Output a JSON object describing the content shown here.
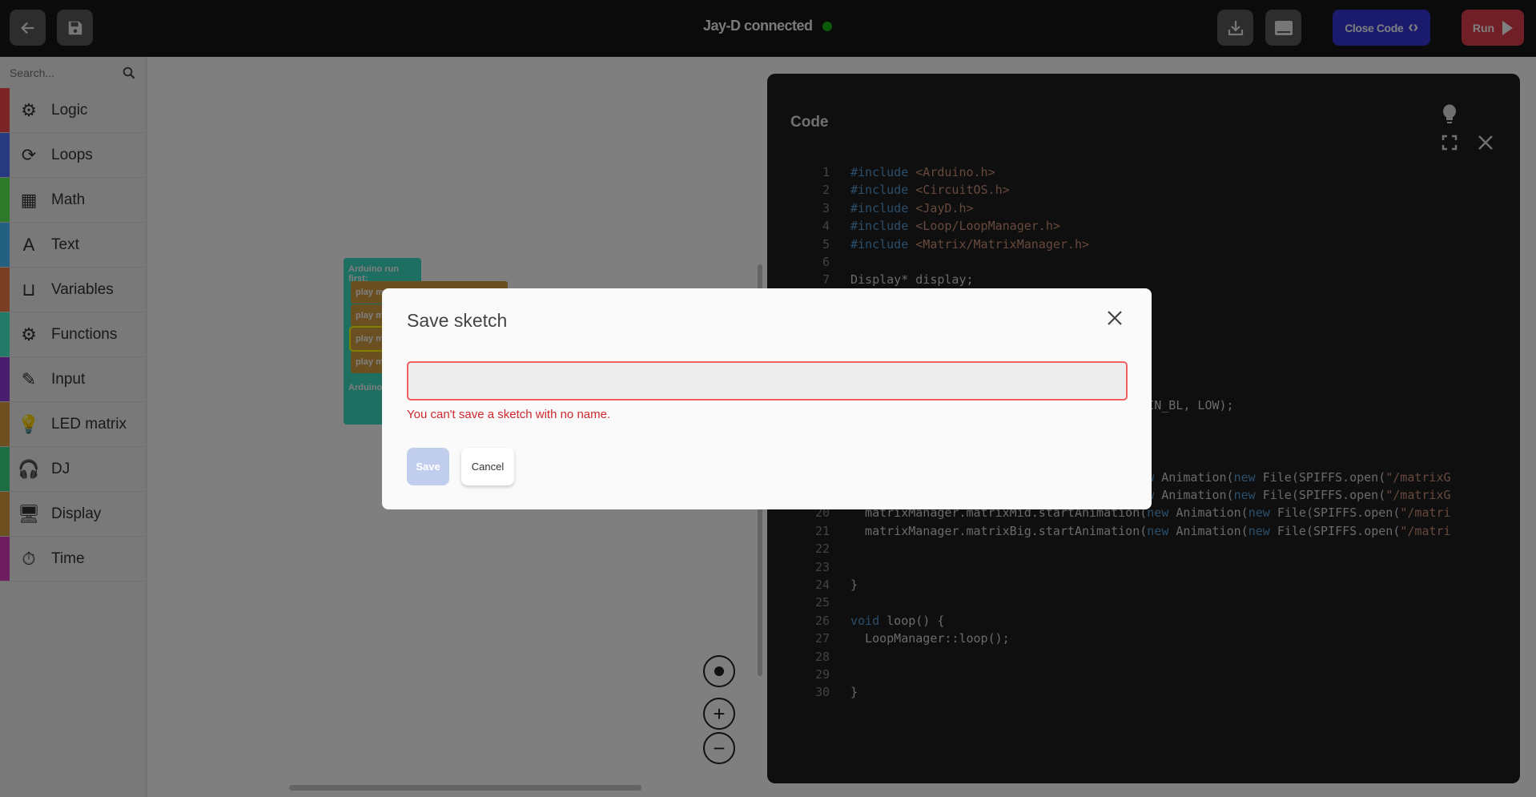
{
  "topbar": {
    "status": "Jay-D connected",
    "status_color": "#14b414",
    "close_code_label": "Close Code",
    "run_label": "Run"
  },
  "sidebar": {
    "search_placeholder": "Search...",
    "items": [
      {
        "label": "Logic",
        "icon": "gears-icon",
        "glyph": "⚙",
        "color": "#fa4a4c"
      },
      {
        "label": "Loops",
        "icon": "refresh-icon",
        "glyph": "⟳",
        "color": "#5074ff"
      },
      {
        "label": "Math",
        "icon": "calculator-icon",
        "glyph": "▦",
        "color": "#5ef454"
      },
      {
        "label": "Text",
        "icon": "font-icon",
        "glyph": "A",
        "color": "#48c0ff"
      },
      {
        "label": "Variables",
        "icon": "inbox-icon",
        "glyph": "⊔",
        "color": "#f47c44"
      },
      {
        "label": "Functions",
        "icon": "cog-icon",
        "glyph": "⚙",
        "color": "#46f4cc"
      },
      {
        "label": "Input",
        "icon": "edit-icon",
        "glyph": "✎",
        "color": "#943cdc"
      },
      {
        "label": "LED matrix",
        "icon": "lightbulb-icon",
        "glyph": "💡",
        "color": "#dca040"
      },
      {
        "label": "DJ",
        "icon": "headphones-icon",
        "glyph": "🎧",
        "color": "#3cdc88"
      },
      {
        "label": "Display",
        "icon": "monitor-icon",
        "glyph": "🖥",
        "color": "#dca040"
      },
      {
        "label": "Time",
        "icon": "stopwatch-icon",
        "glyph": "⏱",
        "color": "#dc3cc0"
      }
    ]
  },
  "workspace": {
    "block_setup": "Arduino run first:",
    "play_blocks": [
      "play ma",
      "play ma",
      "play ma",
      "play ma"
    ],
    "block_loop": "Arduino l"
  },
  "code_panel": {
    "title": "Code",
    "lines": [
      {
        "n": "1",
        "tokens": [
          {
            "t": "#include ",
            "k": "kw"
          },
          {
            "t": "<Arduino.h>",
            "k": "str"
          }
        ]
      },
      {
        "n": "2",
        "tokens": [
          {
            "t": "#include ",
            "k": "kw"
          },
          {
            "t": "<CircuitOS.h>",
            "k": "str"
          }
        ]
      },
      {
        "n": "3",
        "tokens": [
          {
            "t": "#include ",
            "k": "kw"
          },
          {
            "t": "<JayD.h>",
            "k": "str"
          }
        ]
      },
      {
        "n": "4",
        "tokens": [
          {
            "t": "#include ",
            "k": "kw"
          },
          {
            "t": "<Loop/LoopManager.h>",
            "k": "str"
          }
        ]
      },
      {
        "n": "5",
        "tokens": [
          {
            "t": "#include ",
            "k": "kw"
          },
          {
            "t": "<Matrix/MatrixManager.h>",
            "k": "str"
          }
        ]
      },
      {
        "n": "6",
        "tokens": []
      },
      {
        "n": "7",
        "tokens": [
          {
            "t": "Display* display;",
            "k": ""
          }
        ]
      },
      {
        "n": "",
        "tokens": []
      },
      {
        "n": "",
        "tokens": []
      },
      {
        "n": "",
        "tokens": []
      },
      {
        "n": "",
        "tokens": []
      },
      {
        "n": "",
        "tokens": []
      },
      {
        "n": "",
        "tokens": []
      },
      {
        "n": "",
        "tokens": [
          {
            "t": "e(PIN_BL, LOW);",
            "k": ""
          }
        ]
      },
      {
        "n": "",
        "tokens": []
      },
      {
        "n": "",
        "tokens": []
      },
      {
        "n": "",
        "tokens": []
      },
      {
        "n": "",
        "tokens": [
          {
            "t": "(",
            "k": ""
          },
          {
            "t": "new",
            "k": "kw"
          },
          {
            "t": " Animation(",
            "k": ""
          },
          {
            "t": "new",
            "k": "kw"
          },
          {
            "t": " File(SPIFFS.open(",
            "k": ""
          },
          {
            "t": "\"/matrixG",
            "k": "str"
          }
        ]
      },
      {
        "n": "",
        "tokens": [
          {
            "t": "(",
            "k": ""
          },
          {
            "t": "new",
            "k": "kw"
          },
          {
            "t": " Animation(",
            "k": ""
          },
          {
            "t": "new",
            "k": "kw"
          },
          {
            "t": " File(SPIFFS.open(",
            "k": ""
          },
          {
            "t": "\"/matrixG",
            "k": "str"
          }
        ]
      },
      {
        "n": "20",
        "tokens": [
          {
            "t": "  matrixManager.matrixMid.startAnimation(",
            "k": ""
          },
          {
            "t": "new",
            "k": "kw"
          },
          {
            "t": " Animation(",
            "k": ""
          },
          {
            "t": "new",
            "k": "kw"
          },
          {
            "t": " File(SPIFFS.open(",
            "k": ""
          },
          {
            "t": "\"/matri",
            "k": "str"
          }
        ]
      },
      {
        "n": "21",
        "tokens": [
          {
            "t": "  matrixManager.matrixBig.startAnimation(",
            "k": ""
          },
          {
            "t": "new",
            "k": "kw"
          },
          {
            "t": " Animation(",
            "k": ""
          },
          {
            "t": "new",
            "k": "kw"
          },
          {
            "t": " File(SPIFFS.open(",
            "k": ""
          },
          {
            "t": "\"/matri",
            "k": "str"
          }
        ]
      },
      {
        "n": "22",
        "tokens": []
      },
      {
        "n": "23",
        "tokens": []
      },
      {
        "n": "24",
        "tokens": [
          {
            "t": "}",
            "k": ""
          }
        ]
      },
      {
        "n": "25",
        "tokens": []
      },
      {
        "n": "26",
        "tokens": [
          {
            "t": "void",
            "k": "kw"
          },
          {
            "t": " loop() {",
            "k": ""
          }
        ]
      },
      {
        "n": "27",
        "tokens": [
          {
            "t": "  LoopManager::loop();",
            "k": ""
          }
        ]
      },
      {
        "n": "28",
        "tokens": []
      },
      {
        "n": "29",
        "tokens": []
      },
      {
        "n": "30",
        "tokens": [
          {
            "t": "}",
            "k": ""
          }
        ]
      }
    ]
  },
  "modal": {
    "title": "Save sketch",
    "input_value": "",
    "error": "You can't save a sketch with no name.",
    "save_label": "Save",
    "cancel_label": "Cancel"
  }
}
